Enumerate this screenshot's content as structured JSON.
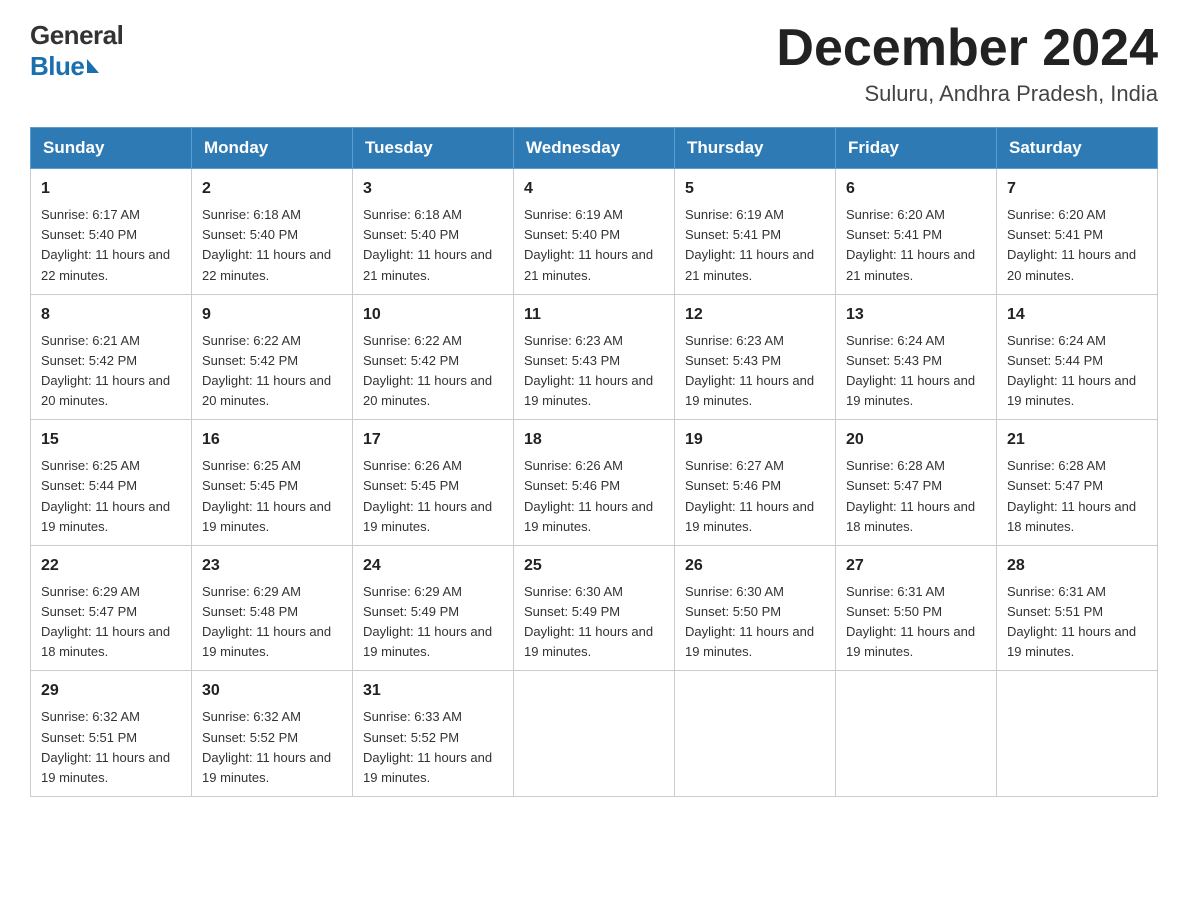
{
  "header": {
    "logo_general": "General",
    "logo_blue": "Blue",
    "month_title": "December 2024",
    "location": "Suluru, Andhra Pradesh, India"
  },
  "weekdays": [
    "Sunday",
    "Monday",
    "Tuesday",
    "Wednesday",
    "Thursday",
    "Friday",
    "Saturday"
  ],
  "weeks": [
    [
      {
        "day": "1",
        "sunrise": "6:17 AM",
        "sunset": "5:40 PM",
        "daylight": "11 hours and 22 minutes."
      },
      {
        "day": "2",
        "sunrise": "6:18 AM",
        "sunset": "5:40 PM",
        "daylight": "11 hours and 22 minutes."
      },
      {
        "day": "3",
        "sunrise": "6:18 AM",
        "sunset": "5:40 PM",
        "daylight": "11 hours and 21 minutes."
      },
      {
        "day": "4",
        "sunrise": "6:19 AM",
        "sunset": "5:40 PM",
        "daylight": "11 hours and 21 minutes."
      },
      {
        "day": "5",
        "sunrise": "6:19 AM",
        "sunset": "5:41 PM",
        "daylight": "11 hours and 21 minutes."
      },
      {
        "day": "6",
        "sunrise": "6:20 AM",
        "sunset": "5:41 PM",
        "daylight": "11 hours and 21 minutes."
      },
      {
        "day": "7",
        "sunrise": "6:20 AM",
        "sunset": "5:41 PM",
        "daylight": "11 hours and 20 minutes."
      }
    ],
    [
      {
        "day": "8",
        "sunrise": "6:21 AM",
        "sunset": "5:42 PM",
        "daylight": "11 hours and 20 minutes."
      },
      {
        "day": "9",
        "sunrise": "6:22 AM",
        "sunset": "5:42 PM",
        "daylight": "11 hours and 20 minutes."
      },
      {
        "day": "10",
        "sunrise": "6:22 AM",
        "sunset": "5:42 PM",
        "daylight": "11 hours and 20 minutes."
      },
      {
        "day": "11",
        "sunrise": "6:23 AM",
        "sunset": "5:43 PM",
        "daylight": "11 hours and 19 minutes."
      },
      {
        "day": "12",
        "sunrise": "6:23 AM",
        "sunset": "5:43 PM",
        "daylight": "11 hours and 19 minutes."
      },
      {
        "day": "13",
        "sunrise": "6:24 AM",
        "sunset": "5:43 PM",
        "daylight": "11 hours and 19 minutes."
      },
      {
        "day": "14",
        "sunrise": "6:24 AM",
        "sunset": "5:44 PM",
        "daylight": "11 hours and 19 minutes."
      }
    ],
    [
      {
        "day": "15",
        "sunrise": "6:25 AM",
        "sunset": "5:44 PM",
        "daylight": "11 hours and 19 minutes."
      },
      {
        "day": "16",
        "sunrise": "6:25 AM",
        "sunset": "5:45 PM",
        "daylight": "11 hours and 19 minutes."
      },
      {
        "day": "17",
        "sunrise": "6:26 AM",
        "sunset": "5:45 PM",
        "daylight": "11 hours and 19 minutes."
      },
      {
        "day": "18",
        "sunrise": "6:26 AM",
        "sunset": "5:46 PM",
        "daylight": "11 hours and 19 minutes."
      },
      {
        "day": "19",
        "sunrise": "6:27 AM",
        "sunset": "5:46 PM",
        "daylight": "11 hours and 19 minutes."
      },
      {
        "day": "20",
        "sunrise": "6:28 AM",
        "sunset": "5:47 PM",
        "daylight": "11 hours and 18 minutes."
      },
      {
        "day": "21",
        "sunrise": "6:28 AM",
        "sunset": "5:47 PM",
        "daylight": "11 hours and 18 minutes."
      }
    ],
    [
      {
        "day": "22",
        "sunrise": "6:29 AM",
        "sunset": "5:47 PM",
        "daylight": "11 hours and 18 minutes."
      },
      {
        "day": "23",
        "sunrise": "6:29 AM",
        "sunset": "5:48 PM",
        "daylight": "11 hours and 19 minutes."
      },
      {
        "day": "24",
        "sunrise": "6:29 AM",
        "sunset": "5:49 PM",
        "daylight": "11 hours and 19 minutes."
      },
      {
        "day": "25",
        "sunrise": "6:30 AM",
        "sunset": "5:49 PM",
        "daylight": "11 hours and 19 minutes."
      },
      {
        "day": "26",
        "sunrise": "6:30 AM",
        "sunset": "5:50 PM",
        "daylight": "11 hours and 19 minutes."
      },
      {
        "day": "27",
        "sunrise": "6:31 AM",
        "sunset": "5:50 PM",
        "daylight": "11 hours and 19 minutes."
      },
      {
        "day": "28",
        "sunrise": "6:31 AM",
        "sunset": "5:51 PM",
        "daylight": "11 hours and 19 minutes."
      }
    ],
    [
      {
        "day": "29",
        "sunrise": "6:32 AM",
        "sunset": "5:51 PM",
        "daylight": "11 hours and 19 minutes."
      },
      {
        "day": "30",
        "sunrise": "6:32 AM",
        "sunset": "5:52 PM",
        "daylight": "11 hours and 19 minutes."
      },
      {
        "day": "31",
        "sunrise": "6:33 AM",
        "sunset": "5:52 PM",
        "daylight": "11 hours and 19 minutes."
      },
      null,
      null,
      null,
      null
    ]
  ]
}
